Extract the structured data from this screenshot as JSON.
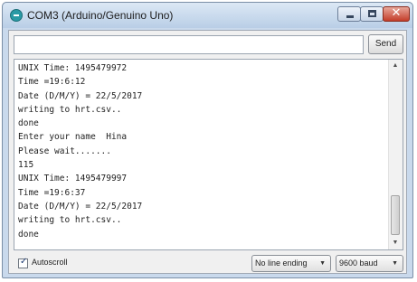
{
  "window": {
    "title": "COM3 (Arduino/Genuino Uno)",
    "close_glyph": "✕"
  },
  "input": {
    "value": "",
    "send_label": "Send"
  },
  "output": {
    "lines": [
      "UNIX Time: 1495479972",
      "Time =19:6:12",
      "Date (D/M/Y) = 22/5/2017",
      "writing to hrt.csv..",
      "done",
      "Enter your name  Hina",
      "Please wait.......",
      "115",
      "UNIX Time: 1495479997",
      "Time =19:6:37",
      "Date (D/M/Y) = 22/5/2017",
      "writing to hrt.csv..",
      "done"
    ],
    "scroll_up_glyph": "▲",
    "scroll_down_glyph": "▼"
  },
  "footer": {
    "autoscroll_label": "Autoscroll",
    "autoscroll_checked": true,
    "check_glyph": "✓",
    "line_ending_selected": "No line ending",
    "baud_selected": "9600 baud",
    "dropdown_glyph": "▼"
  },
  "icons": {
    "app": "arduino-icon",
    "minimize": "minimize-icon",
    "maximize": "maximize-icon",
    "close": "close-icon"
  },
  "colors": {
    "titlebar": "#c9d9ec",
    "close_button": "#c43d2a",
    "app_icon": "#2a9aa5"
  }
}
